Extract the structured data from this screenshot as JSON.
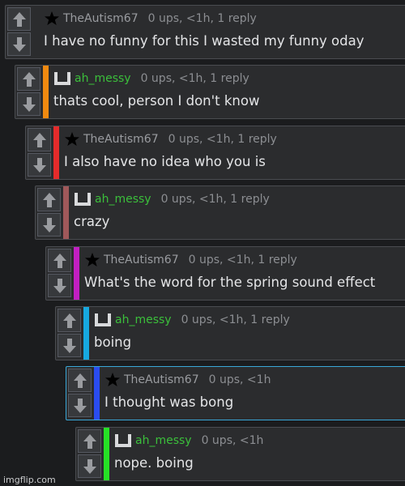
{
  "colors": {
    "background": "#1b1c1e",
    "panel": "#2b2c2e",
    "user_green": "#3bbf3b",
    "user_gray": "#9a9ca0",
    "stats_gray": "#8c8e92",
    "highlight_border": "#3aa7d8"
  },
  "comments": [
    {
      "username": "TheAutism67",
      "icon": "star-icon",
      "stats": "0 ups, <1h, 1 reply",
      "text": "I have no funny for this I wasted my funny oday",
      "bar_color": "none"
    },
    {
      "username": "ah_messy",
      "icon": "bucket-icon",
      "stats": "0 ups, <1h, 1 reply",
      "text": "thats cool, person I don't know",
      "bar_color": "#f08a10"
    },
    {
      "username": "TheAutism67",
      "icon": "star-icon",
      "stats": "0 ups, <1h, 1 reply",
      "text": "I also have no idea who you is",
      "bar_color": "#e52b2b"
    },
    {
      "username": "ah_messy",
      "icon": "bucket-icon",
      "stats": "0 ups, <1h, 1 reply",
      "text": "crazy",
      "bar_color": "#a0585a"
    },
    {
      "username": "TheAutism67",
      "icon": "star-icon",
      "stats": "0 ups, <1h, 1 reply",
      "text": "What's the word for the spring sound effect",
      "bar_color": "#c21fc2"
    },
    {
      "username": "ah_messy",
      "icon": "bucket-icon",
      "stats": "0 ups, <1h, 1 reply",
      "text": "boing",
      "bar_color": "#17a9e0"
    },
    {
      "username": "TheAutism67",
      "icon": "star-icon",
      "stats": "0 ups, <1h",
      "text": "I thought was bong",
      "bar_color": "#2a4cf0"
    },
    {
      "username": "ah_messy",
      "icon": "bucket-icon",
      "stats": "0 ups, <1h",
      "text": "nope. boing",
      "bar_color": "#26e026"
    }
  ],
  "watermark": "imgflip.com"
}
